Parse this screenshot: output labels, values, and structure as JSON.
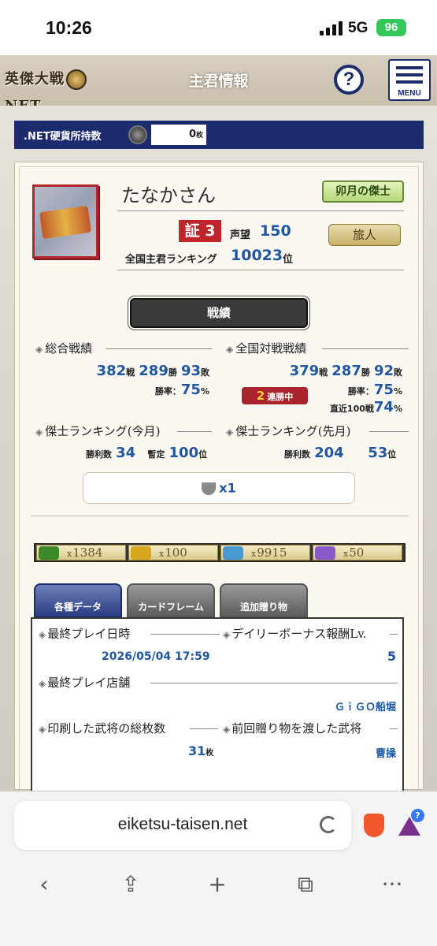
{
  "status_bar": {
    "time": "10:26",
    "network": "5G",
    "battery": "96"
  },
  "header": {
    "logo_text": "英傑大戦",
    "logo_suffix": "NET",
    "title": "主君情報",
    "help_label": "?",
    "menu_label": "MENU"
  },
  "coin_bar": {
    "label": ".NET硬貨所持数",
    "value": "0",
    "unit": "枚"
  },
  "profile": {
    "name": "たなかさん",
    "title_badge": "卯月の傑士",
    "cert_prefix": "証",
    "cert_level": "3",
    "fame_label": "声望",
    "fame_value": "150",
    "rank_badge": "旅人",
    "national_rank_label": "全国主君ランキング",
    "national_rank_value": "10023",
    "national_rank_unit": "位"
  },
  "record": {
    "header": "戦績",
    "overall": {
      "title": "総合戦績",
      "battles": "382",
      "battles_unit": "戦",
      "wins": "289",
      "wins_unit": "勝",
      "losses": "93",
      "losses_unit": "敗",
      "rate_label": "勝率：",
      "rate_value": "75",
      "rate_unit": "%"
    },
    "national": {
      "title": "全国対戦戦績",
      "battles": "379",
      "battles_unit": "戦",
      "wins": "287",
      "wins_unit": "勝",
      "losses": "92",
      "losses_unit": "敗",
      "streak_value": "2",
      "streak_label": "連勝中",
      "rate_label": "勝率：",
      "rate_value": "75",
      "rate_unit": "%",
      "recent_label": "直近100戦",
      "recent_value": "74",
      "recent_unit": "%"
    },
    "ranking_this_month": {
      "title": "傑士ランキング(今月)",
      "wins_label": "勝利数",
      "wins_value": "34",
      "provisional_label": "暫定",
      "rank_value": "100",
      "rank_unit": "位"
    },
    "ranking_last_month": {
      "title": "傑士ランキング(先月)",
      "wins_label": "勝利数",
      "wins_value": "204",
      "rank_value": "53",
      "rank_unit": "位"
    },
    "trophy_count": "x1"
  },
  "items": [
    {
      "icon": "green-gem-icon",
      "prefix": "x",
      "count": "1384",
      "color": "#3d8a2a"
    },
    {
      "icon": "gold-ticket-icon",
      "prefix": "x",
      "count": "100",
      "color": "#d9a620"
    },
    {
      "icon": "blue-crystal-icon",
      "prefix": "x",
      "count": "9915",
      "color": "#4a9ad0"
    },
    {
      "icon": "purple-flower-icon",
      "prefix": "x",
      "count": "50",
      "color": "#8a5ac8"
    }
  ],
  "tabs": [
    {
      "label": "各種データ",
      "active": true
    },
    {
      "label": "カードフレーム",
      "active": false
    },
    {
      "label": "追加贈り物",
      "active": false
    }
  ],
  "data_panel": {
    "last_play_label": "最終プレイ日時",
    "last_play_value": "2026/05/04 17:59",
    "daily_bonus_label": "デイリーボーナス報酬Lv.",
    "daily_bonus_value": "5",
    "last_store_label": "最終プレイ店舗",
    "last_store_value": "ＧｉＧＯ船堀",
    "printed_label": "印刷した武将の総枚数",
    "printed_value": "31",
    "printed_unit": "枚",
    "last_gift_label": "前回贈り物を渡した武将",
    "last_gift_value": "曹操"
  },
  "browser": {
    "url": "eiketsu-taisen.net",
    "nav": [
      "back-icon",
      "share-icon",
      "new-tab-icon",
      "tabs-icon",
      "more-icon"
    ]
  },
  "colors": {
    "accent_blue": "#1f57a3",
    "header_navy": "#1c2a6e",
    "cert_red": "#c0252b",
    "battery_green": "#34c759"
  }
}
